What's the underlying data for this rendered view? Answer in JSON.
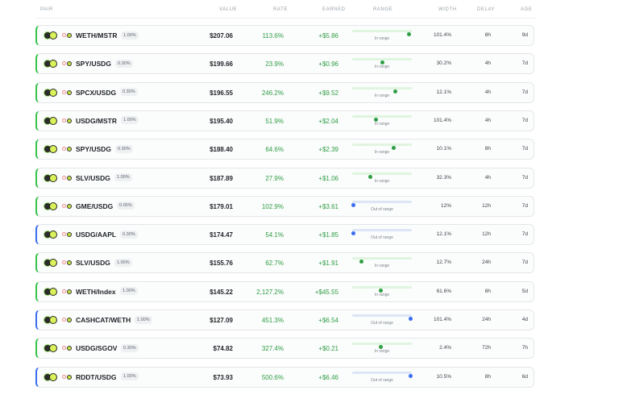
{
  "headers": {
    "pair": "PAIR",
    "value": "VALUE",
    "rate": "RATE",
    "earned": "EARNED",
    "range": "RANGE",
    "width": "WIDTH",
    "delay": "DELAY",
    "age": "AGE"
  },
  "colors": {
    "in_range": "#2f9e44",
    "out_of_range": "#3a6df0",
    "rate_text": "#2f9e44"
  },
  "rows": [
    {
      "pair": "WETH/MSTR",
      "fee": "1.00%",
      "value": "$207.06",
      "rate": "113.6%",
      "earned": "+$5.86",
      "range_status": "In range",
      "range_pos": 0.95,
      "width": "101.4%",
      "delay": "8h",
      "age": "9d",
      "accent": "green"
    },
    {
      "pair": "SPY/USDG",
      "fee": "0.30%",
      "value": "$199.66",
      "rate": "23.9%",
      "earned": "+$0.96",
      "range_status": "In range",
      "range_pos": 0.5,
      "width": "30.2%",
      "delay": "4h",
      "age": "7d",
      "accent": "green"
    },
    {
      "pair": "SPCX/USDG",
      "fee": "0.30%",
      "value": "$196.55",
      "rate": "246.2%",
      "earned": "+$9.52",
      "range_status": "In range",
      "range_pos": 0.72,
      "width": "12.1%",
      "delay": "4h",
      "age": "7d",
      "accent": "green"
    },
    {
      "pair": "USDG/MSTR",
      "fee": "1.00%",
      "value": "$195.40",
      "rate": "51.9%",
      "earned": "+$2.04",
      "range_status": "In range",
      "range_pos": 0.4,
      "width": "101.4%",
      "delay": "4h",
      "age": "7d",
      "accent": "green"
    },
    {
      "pair": "SPY/USDG",
      "fee": "0.30%",
      "value": "$188.40",
      "rate": "64.6%",
      "earned": "+$2.39",
      "range_status": "In range",
      "range_pos": 0.7,
      "width": "10.1%",
      "delay": "8h",
      "age": "7d",
      "accent": "green"
    },
    {
      "pair": "SLV/USDG",
      "fee": "1.00%",
      "value": "$187.89",
      "rate": "27.9%",
      "earned": "+$1.06",
      "range_status": "In range",
      "range_pos": 0.3,
      "width": "32.3%",
      "delay": "4h",
      "age": "7d",
      "accent": "green"
    },
    {
      "pair": "GME/USDG",
      "fee": "0.05%",
      "value": "$179.01",
      "rate": "102.9%",
      "earned": "+$3.61",
      "range_status": "Out of range",
      "range_pos": 0.02,
      "width": "12%",
      "delay": "12h",
      "age": "7d",
      "accent": "green"
    },
    {
      "pair": "USDG/AAPL",
      "fee": "0.30%",
      "value": "$174.47",
      "rate": "54.1%",
      "earned": "+$1.85",
      "range_status": "Out of range",
      "range_pos": 0.02,
      "width": "12.1%",
      "delay": "12h",
      "age": "7d",
      "accent": "blue"
    },
    {
      "pair": "SLV/USDG",
      "fee": "1.00%",
      "value": "$155.76",
      "rate": "62.7%",
      "earned": "+$1.91",
      "range_status": "In range",
      "range_pos": 0.15,
      "width": "12.7%",
      "delay": "24h",
      "age": "7d",
      "accent": "green"
    },
    {
      "pair": "WETH/Index",
      "fee": "1.00%",
      "value": "$145.22",
      "rate": "2,127.2%",
      "earned": "+$45.55",
      "range_status": "In range",
      "range_pos": 0.48,
      "width": "61.6%",
      "delay": "8h",
      "age": "5d",
      "accent": "green"
    },
    {
      "pair": "CASHCAT/WETH",
      "fee": "1.00%",
      "value": "$127.09",
      "rate": "451.3%",
      "earned": "+$6.54",
      "range_status": "Out of range",
      "range_pos": 0.98,
      "width": "101.4%",
      "delay": "24h",
      "age": "4d",
      "accent": "blue"
    },
    {
      "pair": "USDG/SGOV",
      "fee": "0.30%",
      "value": "$74.82",
      "rate": "327.4%",
      "earned": "+$0.21",
      "range_status": "In range",
      "range_pos": 0.48,
      "width": "2.4%",
      "delay": "72h",
      "age": "7h",
      "accent": "green"
    },
    {
      "pair": "RDDT/USDG",
      "fee": "1.00%",
      "value": "$73.93",
      "rate": "500.6%",
      "earned": "+$6.46",
      "range_status": "Out of range",
      "range_pos": 0.98,
      "width": "10.5%",
      "delay": "8h",
      "age": "6d",
      "accent": "blue"
    }
  ]
}
